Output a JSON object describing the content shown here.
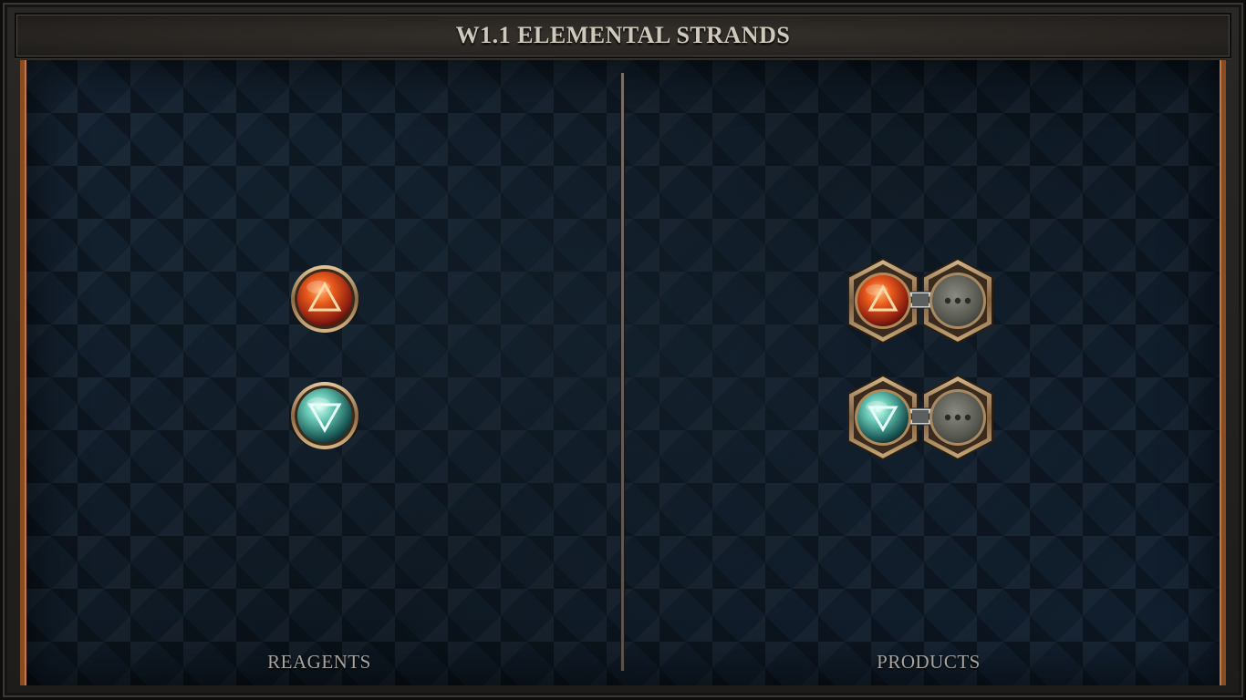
{
  "header": {
    "title": "W1.1 ELEMENTAL STRANDS"
  },
  "reagents": {
    "label": "REAGENTS",
    "items": [
      {
        "element": "fire",
        "symbol": "fire-triangle-icon",
        "color": "#e2561c"
      },
      {
        "element": "water",
        "symbol": "water-triangle-icon",
        "color": "#4fb8a6"
      }
    ]
  },
  "products": {
    "label": "PRODUCTS",
    "items": [
      {
        "element": "fire",
        "symbol": "fire-triangle-icon",
        "color": "#e2561c",
        "linked_slot": "empty-slot"
      },
      {
        "element": "water",
        "symbol": "water-triangle-icon",
        "color": "#4fb8a6",
        "linked_slot": "empty-slot"
      }
    ]
  },
  "colors": {
    "frame_accent": "#8a4a22",
    "bronze": "#b08a5a",
    "board_bg": "#0f1a25"
  }
}
